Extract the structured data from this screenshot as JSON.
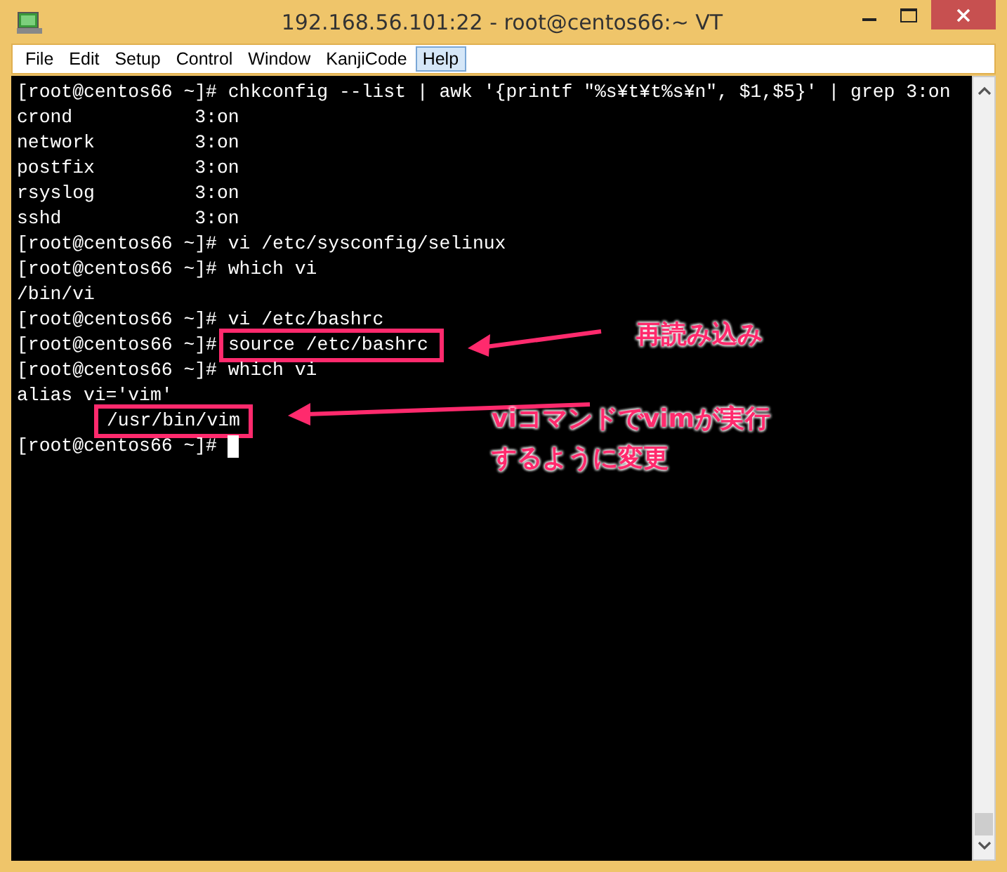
{
  "window": {
    "title": "192.168.56.101:22 - root@centos66:~ VT"
  },
  "menu": [
    {
      "label": "File",
      "selected": false
    },
    {
      "label": "Edit",
      "selected": false
    },
    {
      "label": "Setup",
      "selected": false
    },
    {
      "label": "Control",
      "selected": false
    },
    {
      "label": "Window",
      "selected": false
    },
    {
      "label": "KanjiCode",
      "selected": false
    },
    {
      "label": "Help",
      "selected": true
    }
  ],
  "terminal": {
    "lines": [
      {
        "text": "[root@centos66 ~]# chkconfig --list | awk '{printf \"%s¥t¥t%s¥n\", $1,$5}' | grep 3:on",
        "highlighted": false
      },
      {
        "text": "crond           3:on",
        "highlighted": false
      },
      {
        "text": "network         3:on",
        "highlighted": false
      },
      {
        "text": "postfix         3:on",
        "highlighted": false
      },
      {
        "text": "rsyslog         3:on",
        "highlighted": false
      },
      {
        "text": "sshd            3:on",
        "highlighted": false
      },
      {
        "text": "[root@centos66 ~]# vi /etc/sysconfig/selinux",
        "highlighted": false
      },
      {
        "text": "[root@centos66 ~]# which vi",
        "highlighted": false
      },
      {
        "text": "/bin/vi",
        "highlighted": false
      },
      {
        "text": "[root@centos66 ~]# vi /etc/bashrc",
        "highlighted": false
      },
      {
        "prompt": "[root@centos66 ~]#",
        "text": "source /etc/bashrc",
        "highlighted": true
      },
      {
        "text": "[root@centos66 ~]# which vi",
        "highlighted": false
      },
      {
        "text": "alias vi='vim'",
        "highlighted": false
      },
      {
        "text": "/usr/bin/vim",
        "highlighted": true
      },
      {
        "text": "[root@centos66 ~]#",
        "highlighted": false
      }
    ]
  },
  "callouts": [
    {
      "lines": [
        "再読み込み"
      ]
    },
    {
      "lines": [
        "viコマンドでvimが実行",
        "するように変更"
      ]
    }
  ]
}
